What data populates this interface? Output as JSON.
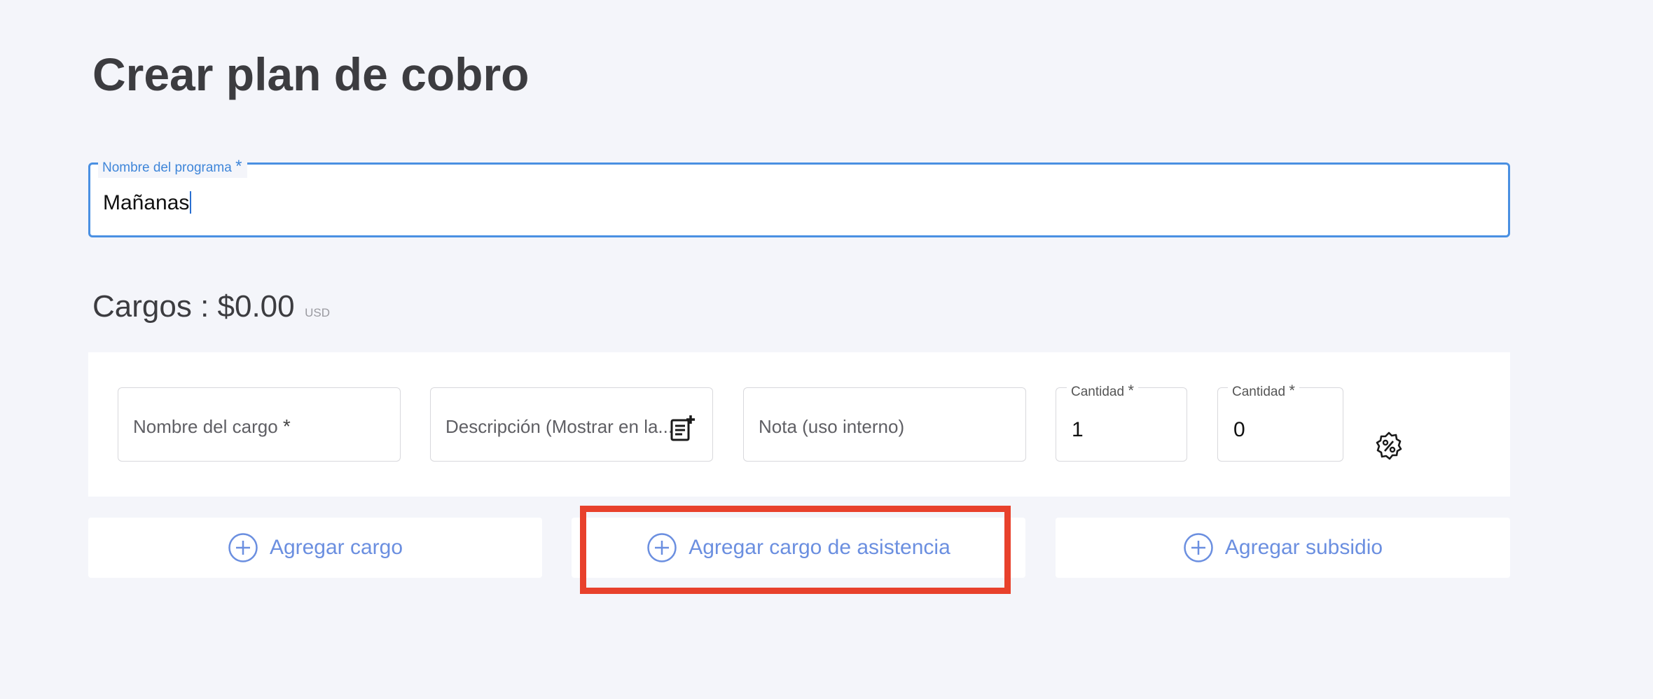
{
  "page": {
    "title": "Crear plan de cobro"
  },
  "program": {
    "label": "Nombre del programa",
    "required_mark": "*",
    "value": "Mañanas"
  },
  "charges": {
    "heading": "Cargos : $0.00",
    "currency": "USD"
  },
  "charge_row": {
    "name_placeholder": "Nombre del cargo",
    "name_required": "*",
    "description_placeholder": "Descripción (Mostrar en la...",
    "note_placeholder": "Nota (uso interno)",
    "quantity1_label": "Cantidad",
    "quantity1_value": "1",
    "quantity2_label": "Cantidad",
    "quantity2_value": "0",
    "required_mark": "*"
  },
  "actions": {
    "add_charge": "Agregar cargo",
    "add_attendance_charge": "Agregar cargo de asistencia",
    "add_subsidy": "Agregar subsidio"
  },
  "colors": {
    "background": "#f4f5fa",
    "focus_border": "#4a90e2",
    "link_blue": "#6b8fe0",
    "highlight": "#e8412c"
  },
  "icons": {
    "description": "note-add-icon",
    "discount": "percent-badge-icon",
    "add": "plus-circle-icon"
  }
}
